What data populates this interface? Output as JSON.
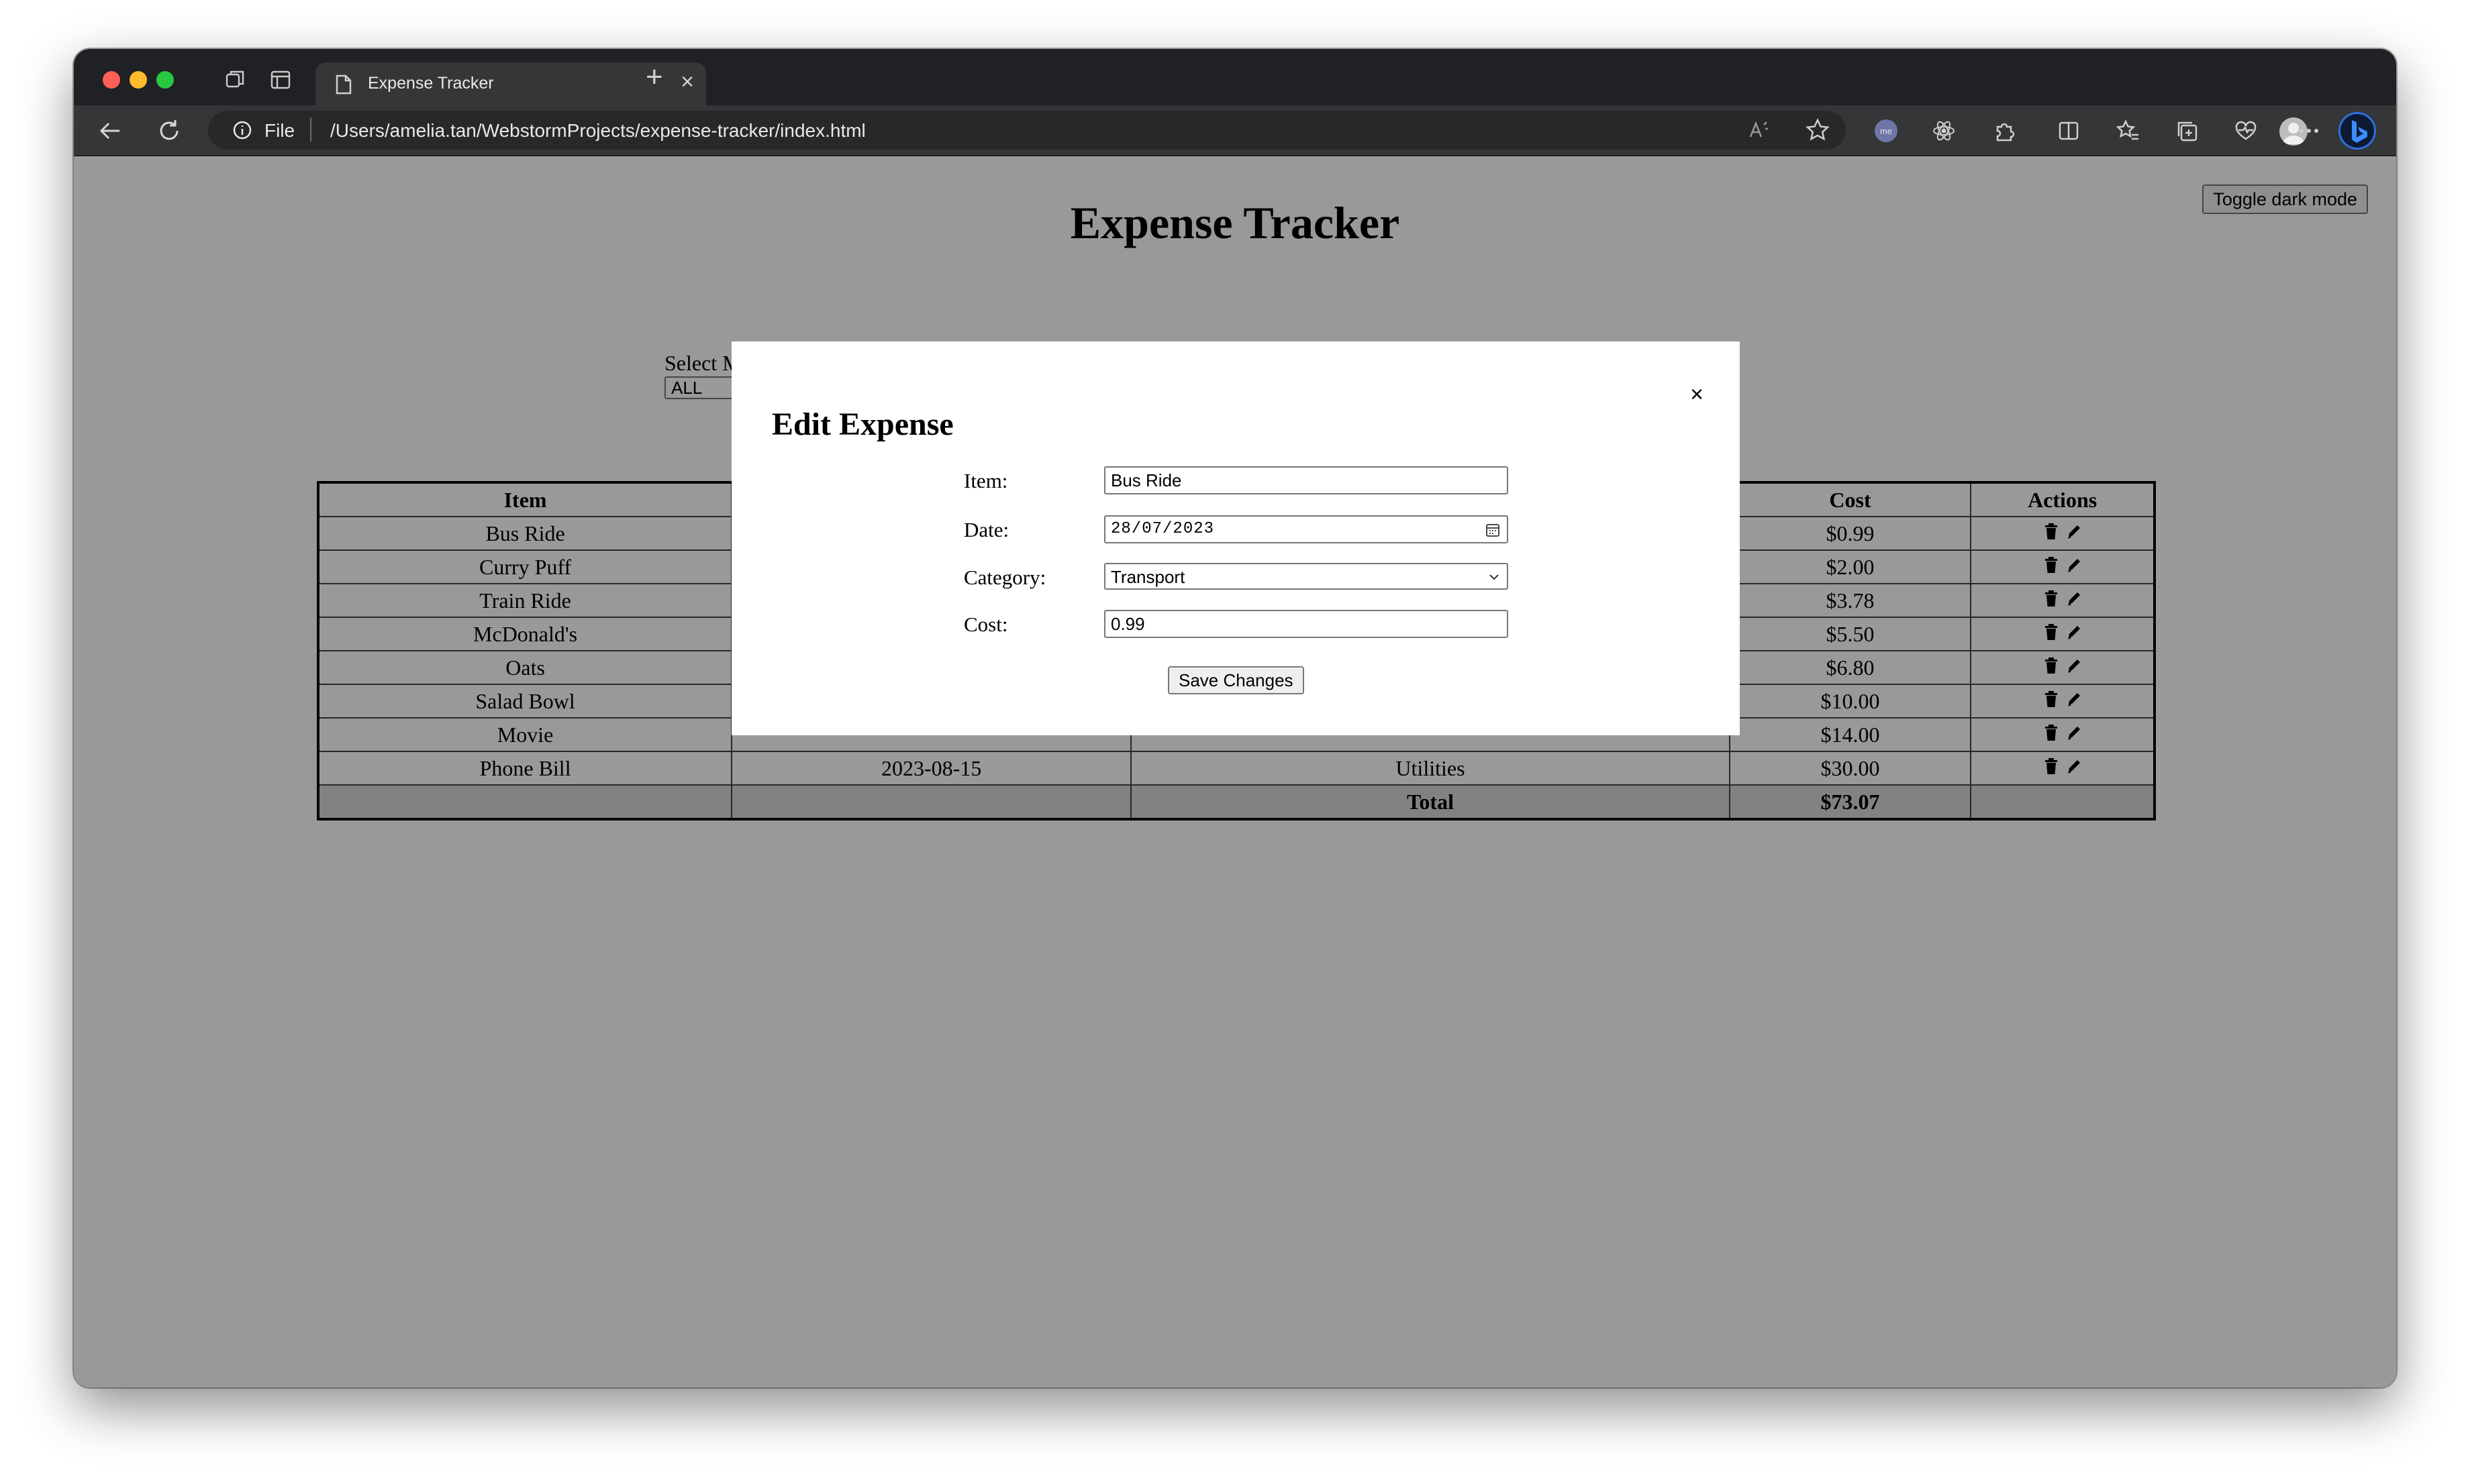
{
  "browser": {
    "tab_title": "Expense Tracker",
    "address_scheme": "File",
    "address_url": "/Users/amelia.tan/WebstormProjects/expense-tracker/index.html"
  },
  "page": {
    "title": "Expense Tracker",
    "dark_mode_button": "Toggle dark mode",
    "filter_label": "Select M",
    "filter_value": "ALL"
  },
  "table": {
    "headers": [
      "Item",
      "",
      "",
      "Cost",
      "Actions"
    ],
    "rows": [
      {
        "item": "Bus Ride",
        "date": "",
        "category": "",
        "cost": "$0.99"
      },
      {
        "item": "Curry Puff",
        "date": "",
        "category": "",
        "cost": "$2.00"
      },
      {
        "item": "Train Ride",
        "date": "",
        "category": "",
        "cost": "$3.78"
      },
      {
        "item": "McDonald's",
        "date": "",
        "category": "",
        "cost": "$5.50"
      },
      {
        "item": "Oats",
        "date": "",
        "category": "",
        "cost": "$6.80"
      },
      {
        "item": "Salad Bowl",
        "date": "",
        "category": "",
        "cost": "$10.00"
      },
      {
        "item": "Movie",
        "date": "",
        "category": "",
        "cost": "$14.00"
      },
      {
        "item": "Phone Bill",
        "date": "2023-08-15",
        "category": "Utilities",
        "cost": "$30.00"
      }
    ],
    "total_label": "Total",
    "total_value": "$73.07"
  },
  "modal": {
    "title": "Edit Expense",
    "close_symbol": "×",
    "item_label": "Item:",
    "item_value": "Bus Ride",
    "date_label": "Date:",
    "date_value": "28/07/2023",
    "category_label": "Category:",
    "category_value": "Transport",
    "cost_label": "Cost:",
    "cost_value": "0.99",
    "save_button": "Save Changes"
  }
}
